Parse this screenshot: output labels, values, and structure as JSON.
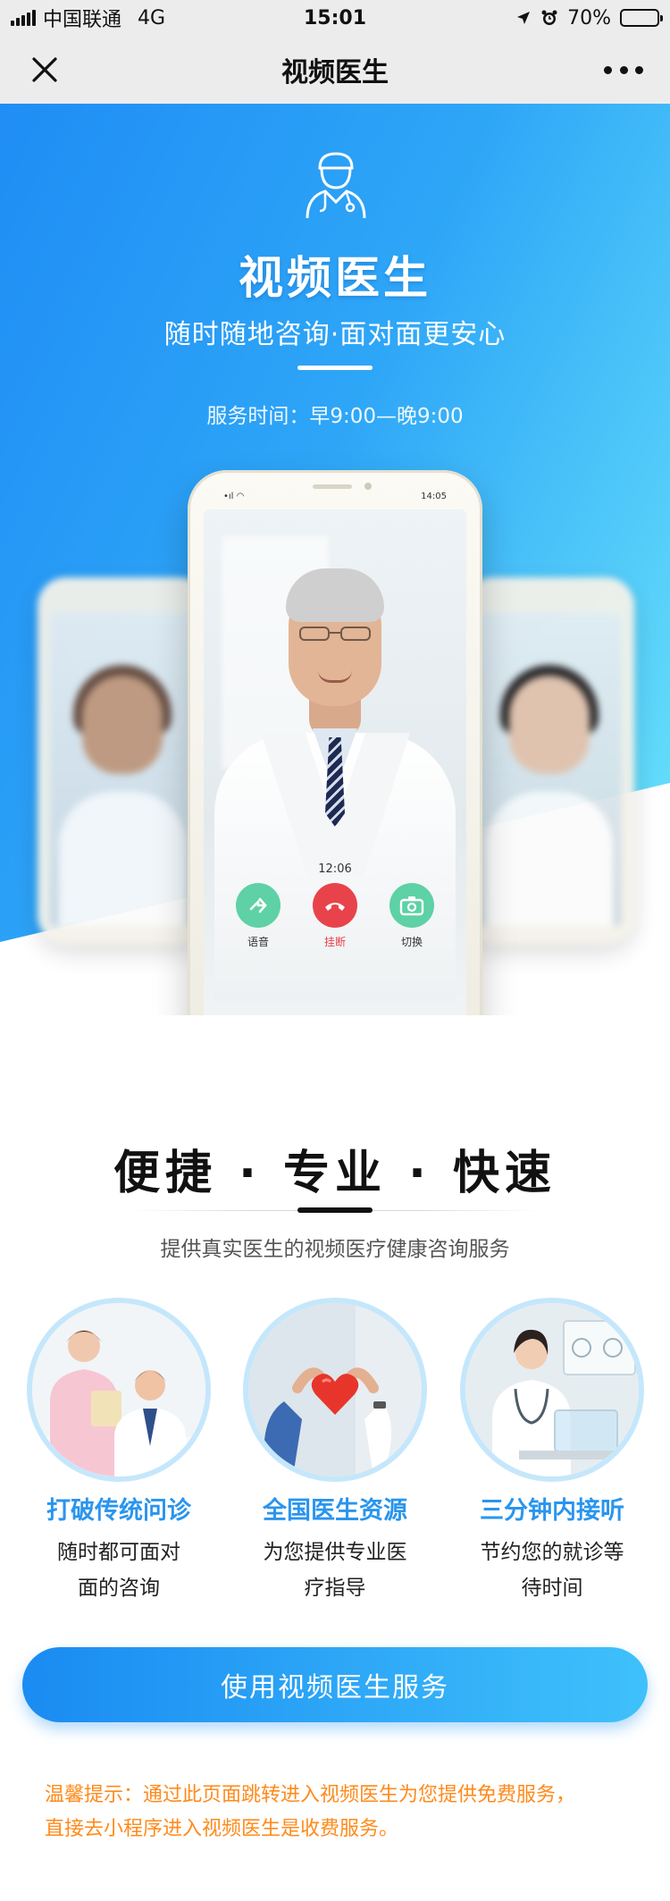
{
  "status_bar": {
    "carrier": "中国联通",
    "network": "4G",
    "time": "15:01",
    "battery": "70%",
    "battery_level": 0.7
  },
  "nav": {
    "title": "视频医生",
    "close_icon": "close-icon",
    "more_icon": "more-icon"
  },
  "hero": {
    "title": "视频医生",
    "subtitle": "随时随地咨询·面对面更安心",
    "hours": "服务时间：早9:00—晚9:00",
    "icon": "doctor-icon",
    "colors": {
      "gradient_start": "#1f8df5",
      "gradient_end": "#6ee7fb"
    }
  },
  "phone": {
    "status_time": "14:05",
    "call_time": "12:06",
    "buttons": {
      "voice": "语音",
      "hangup": "挂断",
      "switch": "切换"
    }
  },
  "features": {
    "title": "便捷 · 专业 · 快速",
    "subtitle": "提供真实医生的视频医疗健康咨询服务",
    "items": [
      {
        "title": "打破传统问诊",
        "desc1": "随时都可面对",
        "desc2": "面的咨询"
      },
      {
        "title": "全国医生资源",
        "desc1": "为您提供专业医",
        "desc2": "疗指导"
      },
      {
        "title": "三分钟内接听",
        "desc1": "节约您的就诊等",
        "desc2": "待时间"
      }
    ]
  },
  "cta": {
    "label": "使用视频医生服务"
  },
  "notice": {
    "line1": "温馨提示：通过此页面跳转进入视频医生为您提供免费服务，",
    "line2": "直接去小程序进入视频医生是收费服务。"
  }
}
